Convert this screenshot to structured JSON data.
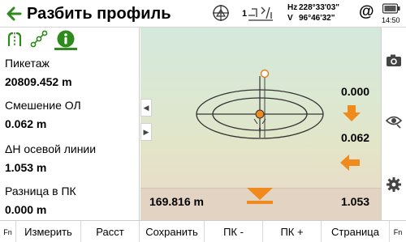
{
  "header": {
    "title": "Разбить профиль",
    "setup_number": "1",
    "hz_label": "Hz",
    "hz_value": "228°33'03\"",
    "v_label": "V",
    "v_value": "96°46'32\"",
    "time": "14:50",
    "icons": [
      "back-arrow-icon",
      "station-icon",
      "setup-icon",
      "at-sign-icon",
      "battery-icon"
    ]
  },
  "tabs": [
    {
      "icon": "profile-tab-icon"
    },
    {
      "icon": "points-tab-icon"
    },
    {
      "icon": "info-tab-icon",
      "selected": true
    }
  ],
  "fields": [
    {
      "label": "Пикетаж",
      "value": "20809.452 m"
    },
    {
      "label": "Смешение ОЛ",
      "value": "0.062 m"
    },
    {
      "label": "ΔH осевой линии",
      "value": "1.053 m"
    },
    {
      "label": "Разница в ПК",
      "value": "0.000 m"
    }
  ],
  "view": {
    "value_top": "0.000",
    "value_mid": "0.062",
    "value_bottom_left": "169.816 m",
    "value_bottom_right": "1.053",
    "accent_color": "#f08a1c"
  },
  "right_toolbar": [
    "camera-icon",
    "eye-icon",
    "gear-icon"
  ],
  "softkeys": {
    "fn_left": "Fn",
    "measure": "Измерить",
    "dist": "Расст",
    "save": "Сохранить",
    "pk_minus": "ПК -",
    "pk_plus": "ПК +",
    "page": "Страница",
    "fn_right": "Fn"
  }
}
